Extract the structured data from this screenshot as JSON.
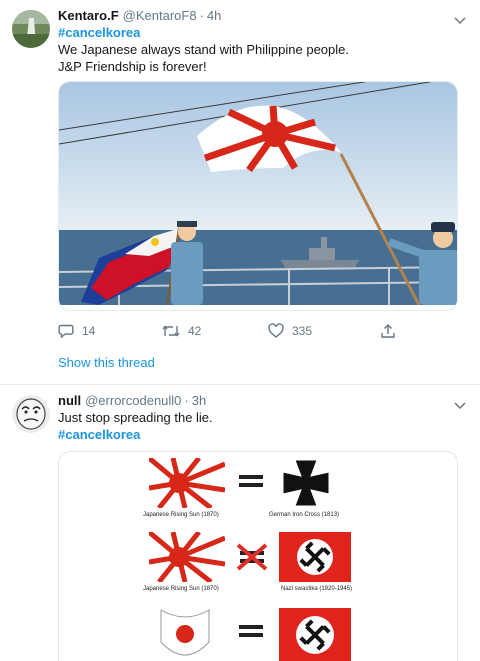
{
  "tweets": [
    {
      "name": "Kentaro.F",
      "handle": "@KentaroF8",
      "sep": "·",
      "time": "4h",
      "hashtag": "#cancelkorea",
      "text_line1": "We Japanese always stand with Philippine people.",
      "text_line2": "J&P Friendship is forever!",
      "replies": "14",
      "retweets": "42",
      "likes": "335",
      "show_thread": "Show this thread"
    },
    {
      "name": "null",
      "handle": "@errorcodenull0",
      "sep": "·",
      "time": "3h",
      "text_line1": "Just stop spreading the lie.",
      "hashtag": "#cancelkorea",
      "captions": {
        "rising_sun_1": "Japanese Rising Sun (1870)",
        "iron_cross": "German Iron Cross (1813)",
        "rising_sun_2": "Japanese Rising Sun (1870)",
        "swastika": "Nazi swastika (1920-1945)"
      }
    }
  ],
  "icons": {
    "reply": "reply-icon",
    "retweet": "retweet-icon",
    "like": "heart-icon",
    "share": "share-icon",
    "more": "chevron-down-icon"
  },
  "colors": {
    "accent": "#1b95e0",
    "muted": "#657786",
    "flag_red": "#d62718"
  }
}
